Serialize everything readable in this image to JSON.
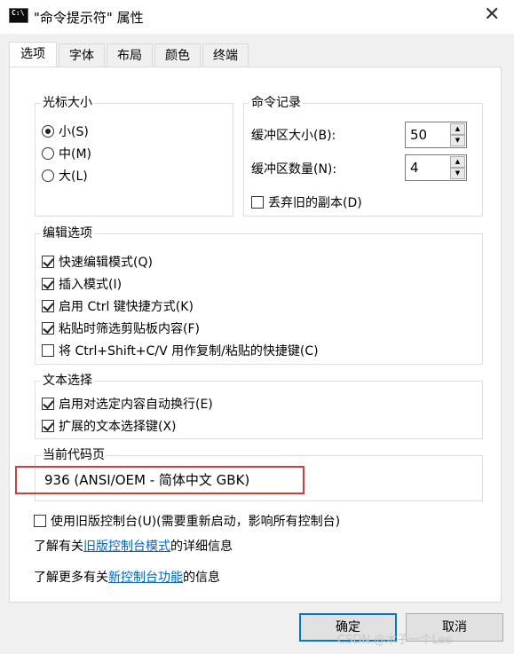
{
  "window": {
    "title": "\"命令提示符\" 属性",
    "icon_text": "C:\\",
    "close_glyph": "✕"
  },
  "tabs": [
    {
      "label": "选项",
      "active": true
    },
    {
      "label": "字体",
      "active": false
    },
    {
      "label": "布局",
      "active": false
    },
    {
      "label": "颜色",
      "active": false
    },
    {
      "label": "终端",
      "active": false
    }
  ],
  "cursor_size": {
    "title": "光标大小",
    "options": [
      {
        "label": "小(S)",
        "selected": true
      },
      {
        "label": "中(M)",
        "selected": false
      },
      {
        "label": "大(L)",
        "selected": false
      }
    ]
  },
  "command_history": {
    "title": "命令记录",
    "buffer_size_label": "缓冲区大小(B):",
    "buffer_size_value": "50",
    "buffer_count_label": "缓冲区数量(N):",
    "buffer_count_value": "4",
    "discard_label": "丢弃旧的副本(D)",
    "discard_checked": false
  },
  "edit_options": {
    "title": "编辑选项",
    "items": [
      {
        "label": "快速编辑模式(Q)",
        "checked": true
      },
      {
        "label": "插入模式(I)",
        "checked": true
      },
      {
        "label": "启用 Ctrl 键快捷方式(K)",
        "checked": true
      },
      {
        "label": "粘贴时筛选剪贴板内容(F)",
        "checked": true
      },
      {
        "label": "将 Ctrl+Shift+C/V 用作复制/粘贴的快捷键(C)",
        "checked": false
      }
    ]
  },
  "text_selection": {
    "title": "文本选择",
    "items": [
      {
        "label": "启用对选定内容自动换行(E)",
        "checked": true
      },
      {
        "label": "扩展的文本选择键(X)",
        "checked": true
      }
    ]
  },
  "code_page": {
    "title": "当前代码页",
    "value": "936   (ANSI/OEM - 简体中文 GBK)"
  },
  "legacy": {
    "label": "使用旧版控制台(U)(需要重新启动，影响所有控制台)",
    "checked": false,
    "info1_prefix": "了解有关",
    "info1_link": "旧版控制台模式",
    "info1_suffix": "的详细信息",
    "info2_prefix": "了解更多有关",
    "info2_link": "新控制台功能",
    "info2_suffix": "的信息"
  },
  "buttons": {
    "ok": "确定",
    "cancel": "取消"
  },
  "watermark": "CSDN @木子一个Lee",
  "colors": {
    "highlight_box": "#e03838",
    "link": "#0066cc",
    "default_button_border": "#0078d7"
  }
}
